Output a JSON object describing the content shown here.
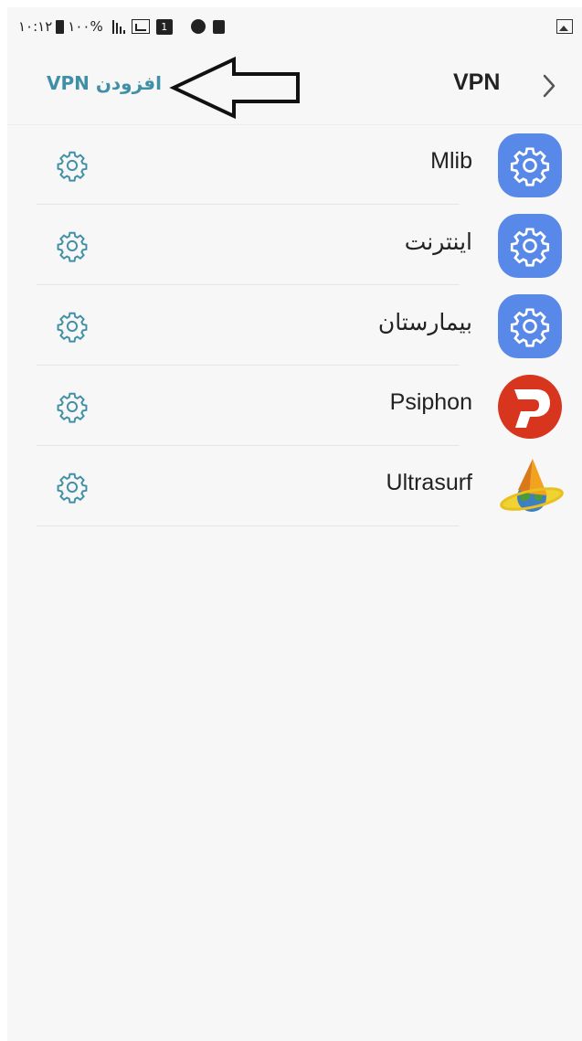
{
  "status_bar": {
    "time": "۱۰:۱۲",
    "battery": "۱۰۰%",
    "sim": "1"
  },
  "app_bar": {
    "title": "VPN",
    "add_label": "افزودن VPN"
  },
  "vpn_list": [
    {
      "label": "Mlib",
      "icon": "settings-gear-icon"
    },
    {
      "label": "اینترنت",
      "icon": "settings-gear-icon"
    },
    {
      "label": "بیمارستان",
      "icon": "settings-gear-icon"
    },
    {
      "label": "Psiphon",
      "icon": "psiphon-icon"
    },
    {
      "label": "Ultrasurf",
      "icon": "ultrasurf-icon"
    }
  ],
  "colors": {
    "accent": "#3f8fa6",
    "settings_icon_bg": "#5889e8",
    "psiphon_red": "#d8351f",
    "background": "#f7f7f7"
  }
}
